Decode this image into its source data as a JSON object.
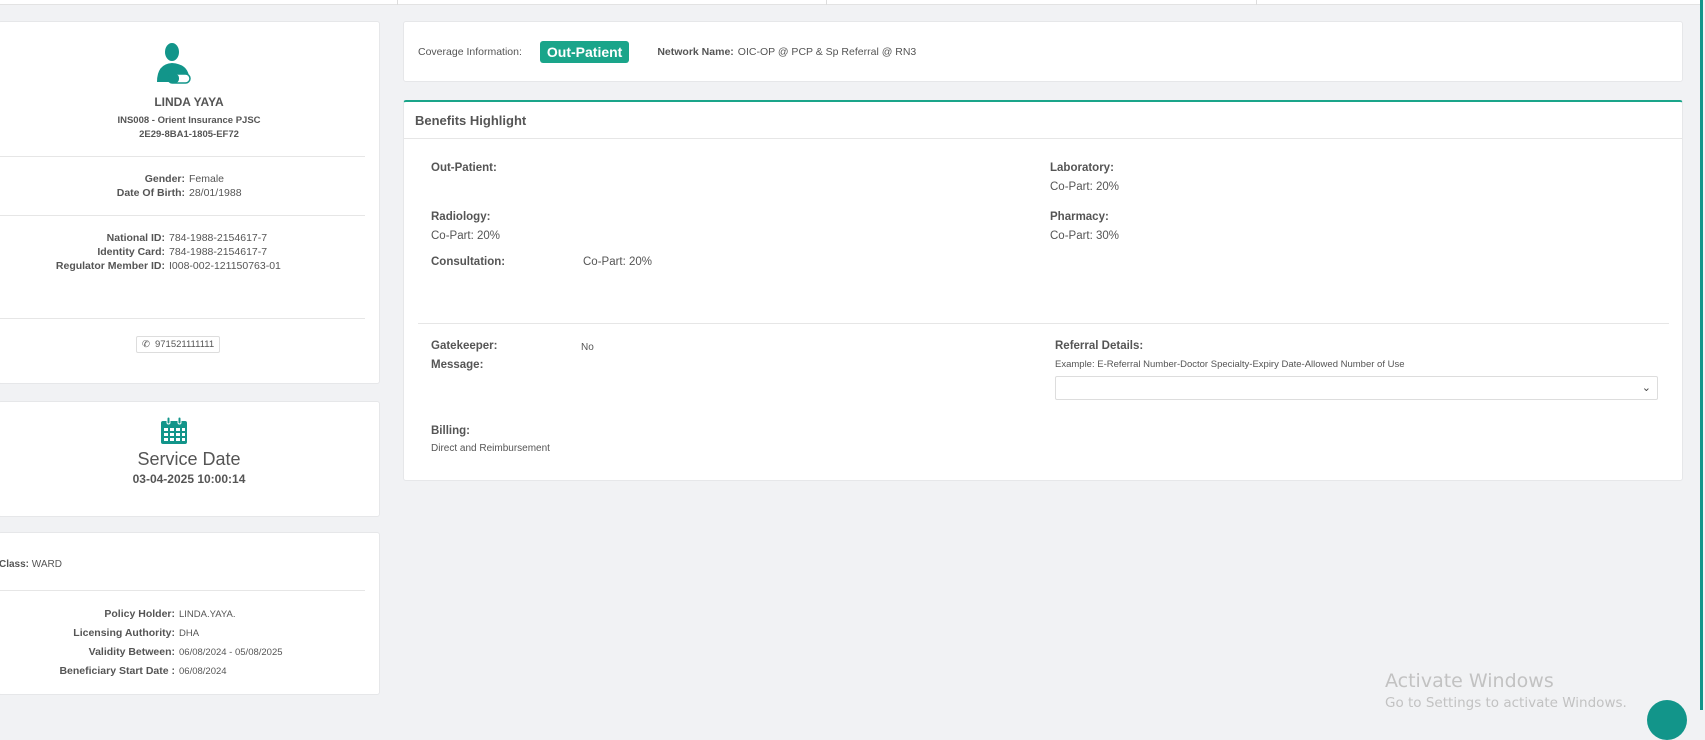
{
  "patient": {
    "name": "LINDA YAYA",
    "insurer": "INS008 - Orient Insurance PJSC",
    "card_code": "2E29-8BA1-1805-EF72",
    "gender_label": "Gender:",
    "gender": "Female",
    "dob_label": "Date Of Birth:",
    "dob": "28/01/1988",
    "national_id_label": "National ID:",
    "national_id": "784-1988-2154617-7",
    "identity_card_label": "Identity Card:",
    "identity_card": "784-1988-2154617-7",
    "regulator_label": "Regulator Member ID:",
    "regulator_id": "I008-002-121150763-01",
    "phone": "971521111111"
  },
  "service": {
    "title": "Service Date",
    "datetime": "03-04-2025 10:00:14"
  },
  "policy": {
    "class_label": "Class:",
    "class": "WARD",
    "holder_label": "Policy Holder:",
    "holder": "LINDA.YAYA.",
    "authority_label": "Licensing Authority:",
    "authority": "DHA",
    "validity_label": "Validity Between:",
    "validity": "06/08/2024 - 05/08/2025",
    "start_label": "Beneficiary Start Date :",
    "start": "06/08/2024"
  },
  "coverage": {
    "label": "Coverage Information:",
    "badge": "Out-Patient",
    "network_label": "Network Name:",
    "network": "OIC-OP @ PCP & Sp Referral @ RN3"
  },
  "benefits": {
    "title": "Benefits Highlight",
    "outpatient_label": "Out-Patient:",
    "laboratory_label": "Laboratory:",
    "laboratory": "Co-Part: 20%",
    "radiology_label": "Radiology:",
    "radiology": "Co-Part: 20%",
    "pharmacy_label": "Pharmacy:",
    "pharmacy": "Co-Part: 30%",
    "consultation_label": "Consultation:",
    "consultation": "Co-Part: 20%",
    "gatekeeper_label": "Gatekeeper:",
    "gatekeeper": "No",
    "message_label": "Message:",
    "billing_label": "Billing:",
    "billing": "Direct and Reimbursement",
    "referral_label": "Referral Details:",
    "referral_hint": "Example: E-Referral Number-Doctor Specialty-Expiry Date-Allowed Number of Use"
  },
  "watermark": {
    "title": "Activate Windows",
    "sub": "Go to Settings to activate Windows."
  },
  "colors": {
    "accent": "#1aa58a",
    "icon": "#12958a"
  }
}
